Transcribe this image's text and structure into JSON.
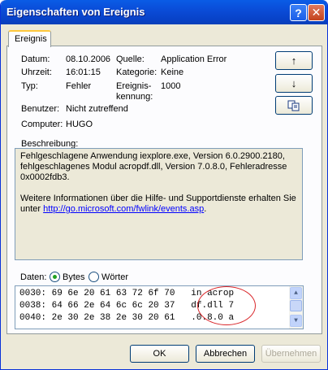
{
  "window": {
    "title": "Eigenschaften von Ereignis",
    "help_button": "?",
    "close_button": "✕"
  },
  "tab": {
    "label": "Ereignis"
  },
  "fields": {
    "datum_label": "Datum:",
    "datum_value": "08.10.2006",
    "uhrzeit_label": "Uhrzeit:",
    "uhrzeit_value": "16:01:15",
    "typ_label": "Typ:",
    "typ_value": "Fehler",
    "benutzer_label": "Benutzer:",
    "benutzer_value": "Nicht zutreffend",
    "computer_label": "Computer:",
    "computer_value": "HUGO",
    "quelle_label": "Quelle:",
    "quelle_value": "Application Error",
    "kategorie_label": "Kategorie:",
    "kategorie_value": "Keine",
    "ereignis_label_1": "Ereignis-",
    "ereignis_label_2": "kennung:",
    "ereignis_value": "1000"
  },
  "nav_buttons": {
    "up_icon": "↑",
    "down_icon": "↓",
    "copy_icon": "copy"
  },
  "description": {
    "label": "Beschreibung:",
    "line1": "Fehlgeschlagene Anwendung iexplore.exe, Version 6.0.2900.2180,",
    "line2": "fehlgeschlagenes Modul acropdf.dll, Version 7.0.8.0, Fehleradresse",
    "line3": "0x0002fdb3.",
    "more_info": "Weitere Informationen über die Hilfe- und Supportdienste erhalten Sie",
    "unter": "unter",
    "link": "http://go.microsoft.com/fwlink/events.asp",
    "period": "."
  },
  "data_section": {
    "label": "Daten:",
    "option_bytes": "Bytes",
    "option_worter": "Wörter",
    "selected": "Bytes",
    "lines": [
      {
        "offset": "0030:",
        "hex": "69 6e 20 61 63 72 6f 70",
        "ascii": "in acrop"
      },
      {
        "offset": "0038:",
        "hex": "64 66 2e 64 6c 6c 20 37",
        "ascii": "df.dll 7"
      },
      {
        "offset": "0040:",
        "hex": "2e 30 2e 38 2e 30 20 61",
        "ascii": ".0.8.0 a"
      }
    ]
  },
  "buttons": {
    "ok": "OK",
    "cancel": "Abbrechen",
    "apply": "Übernehmen"
  },
  "colors": {
    "titlebar": "#0a4bd6",
    "annotation_circle": "#d9262a",
    "link": "#0000ff"
  }
}
